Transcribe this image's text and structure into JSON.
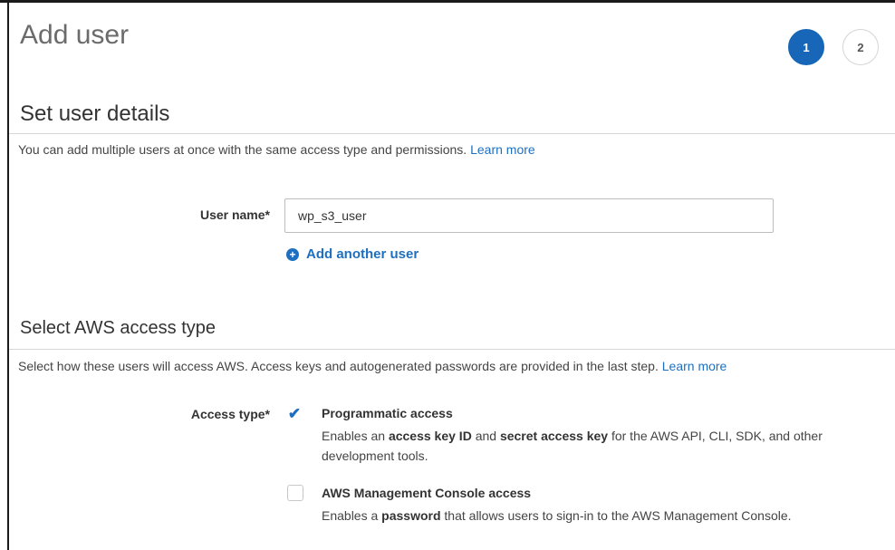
{
  "header": {
    "title": "Add user",
    "steps": [
      "1",
      "2"
    ]
  },
  "details_section": {
    "title": "Set user details",
    "description": "You can add multiple users at once with the same access type and permissions.",
    "learn_more": "Learn more",
    "user_name_label": "User name*",
    "user_name_value": "wp_s3_user",
    "add_another_user": "Add another user"
  },
  "access_section": {
    "title": "Select AWS access type",
    "description": "Select how these users will access AWS. Access keys and autogenerated passwords are provided in the last step.",
    "learn_more": "Learn more",
    "access_type_label": "Access type*",
    "options": [
      {
        "title": "Programmatic access",
        "checked": true,
        "desc_parts": [
          "Enables an ",
          "access key ID",
          " and ",
          "secret access key",
          " for the AWS API, CLI, SDK, and other development tools."
        ]
      },
      {
        "title": "AWS Management Console access",
        "checked": false,
        "desc_parts": [
          "Enables a ",
          "password",
          " that allows users to sign-in to the AWS Management Console."
        ]
      }
    ]
  },
  "colors": {
    "accent": "#1766b8",
    "link": "#1f6fc0"
  },
  "icons": {
    "add": "plus-circle-icon",
    "check": "checkmark-icon"
  }
}
